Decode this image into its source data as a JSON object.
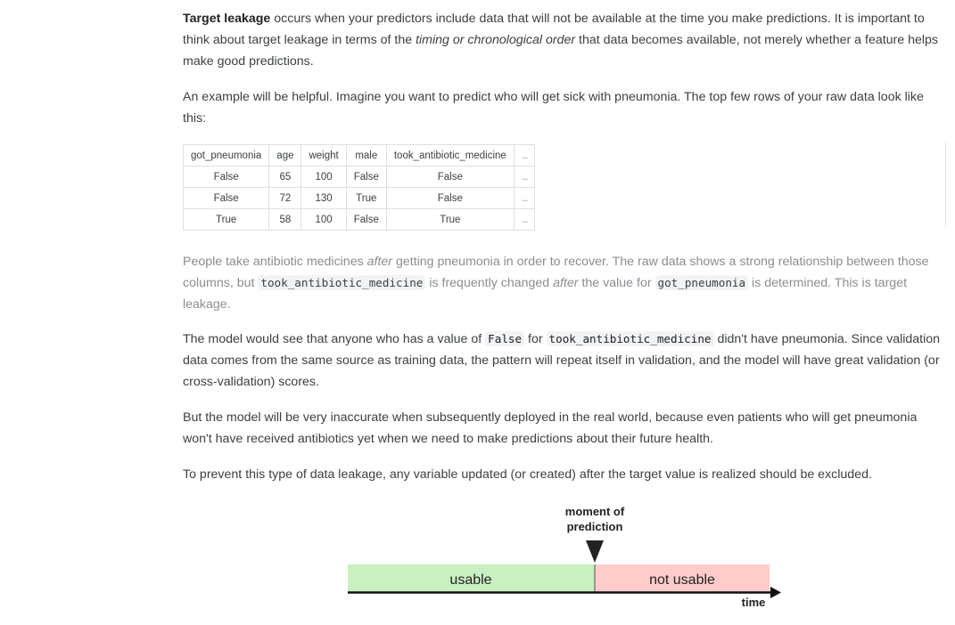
{
  "p1": {
    "bold": "Target leakage",
    "t1": " occurs when your predictors include data that will not be available at the time you make predictions. It is important to think about target leakage in terms of the ",
    "italic": "timing or chronological order",
    "t2": " that data becomes available, not merely whether a feature helps make good predictions."
  },
  "p2": {
    "text": "An example will be helpful. Imagine you want to predict who will get sick with pneumonia. The top few rows of your raw data look like this:"
  },
  "table": {
    "headers": [
      "got_pneumonia",
      "age",
      "weight",
      "male",
      "took_antibiotic_medicine",
      "..."
    ],
    "rows": [
      [
        "False",
        "65",
        "100",
        "False",
        "False",
        "..."
      ],
      [
        "False",
        "72",
        "130",
        "True",
        "False",
        "..."
      ],
      [
        "True",
        "58",
        "100",
        "False",
        "True",
        "..."
      ]
    ]
  },
  "p3": {
    "t1": "People take antibiotic medicines ",
    "i1": "after",
    "t2": " getting pneumonia in order to recover. The raw data shows a strong relationship between those columns, but ",
    "c1": "took_antibiotic_medicine",
    "t3": " is frequently changed ",
    "i2": "after",
    "t4": " the value for ",
    "c2": "got_pneumonia",
    "t5": " is determined. This is target leakage."
  },
  "p4": {
    "t1": "The model would see that anyone who has a value of ",
    "c1": "False",
    "t2": " for ",
    "c2": "took_antibiotic_medicine",
    "t3": " didn't have pneumonia. Since validation data comes from the same source as training data, the pattern will repeat itself in validation, and the model will have great validation (or cross-validation) scores."
  },
  "p5": {
    "text": "But the model will be very inaccurate when subsequently deployed in the real world, because even patients who will get pneumonia won't have received antibiotics yet when we need to make predictions about their future health."
  },
  "p6": {
    "text": "To prevent this type of data leakage, any variable updated (or created) after the target value is realized should be excluded."
  },
  "diagram": {
    "moment_line1": "moment of",
    "moment_line2": "prediction",
    "usable": "usable",
    "not_usable": "not usable",
    "axis_label": "time",
    "usable_color": "#c9f0c0",
    "not_usable_color": "#ffcccc"
  }
}
